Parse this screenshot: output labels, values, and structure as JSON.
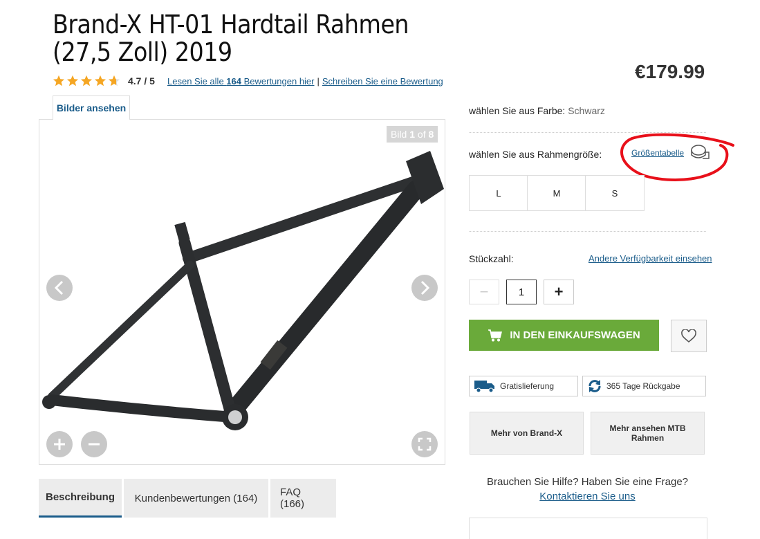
{
  "product": {
    "title_line1": "Brand-X HT-01 Hardtail Rahmen",
    "title_line2": "(27,5 Zoll) 2019",
    "rating": 4.7,
    "rating_text": "4.7 / 5",
    "reviews_prefix": "Lesen Sie alle ",
    "reviews_count": "164",
    "reviews_suffix": " Bewertungen hier",
    "write_review": "Schreiben Sie eine Bewertung",
    "price": "€179.99"
  },
  "gallery": {
    "tab_label": "Bilder ansehen",
    "counter_prefix": "Bild ",
    "counter_current": "1",
    "counter_of": " of ",
    "counter_total": "8"
  },
  "options": {
    "color_label": "wählen Sie aus Farbe:",
    "color_value": "Schwarz",
    "size_label": "wählen Sie aus Rahmengröße:",
    "size_chart_link": "Größentabelle",
    "sizes": [
      "L",
      "M",
      "S"
    ]
  },
  "quantity": {
    "label": "Stückzahl:",
    "availability_link": "Andere Verfügbarkeit einsehen",
    "value": "1",
    "minus": "−",
    "plus": "+"
  },
  "actions": {
    "add_to_cart": "IN DEN EINKAUFSWAGEN",
    "free_delivery": "Gratislieferung",
    "returns": "365 Tage Rückgabe",
    "more_brand": "Mehr von Brand-X",
    "more_category": "Mehr ansehen MTB Rahmen"
  },
  "help": {
    "question": "Brauchen Sie Hilfe? Haben Sie eine Frage?",
    "contact_link": "Kontaktieren Sie uns"
  },
  "tabs": {
    "description": "Beschreibung",
    "reviews": "Kundenbewertungen (164)",
    "faq": "FAQ (166)"
  },
  "colors": {
    "accent_blue": "#1a5c8a",
    "cart_green": "#6aaa3a",
    "star_orange": "#f5a623",
    "annotation_red": "#e8101a"
  }
}
